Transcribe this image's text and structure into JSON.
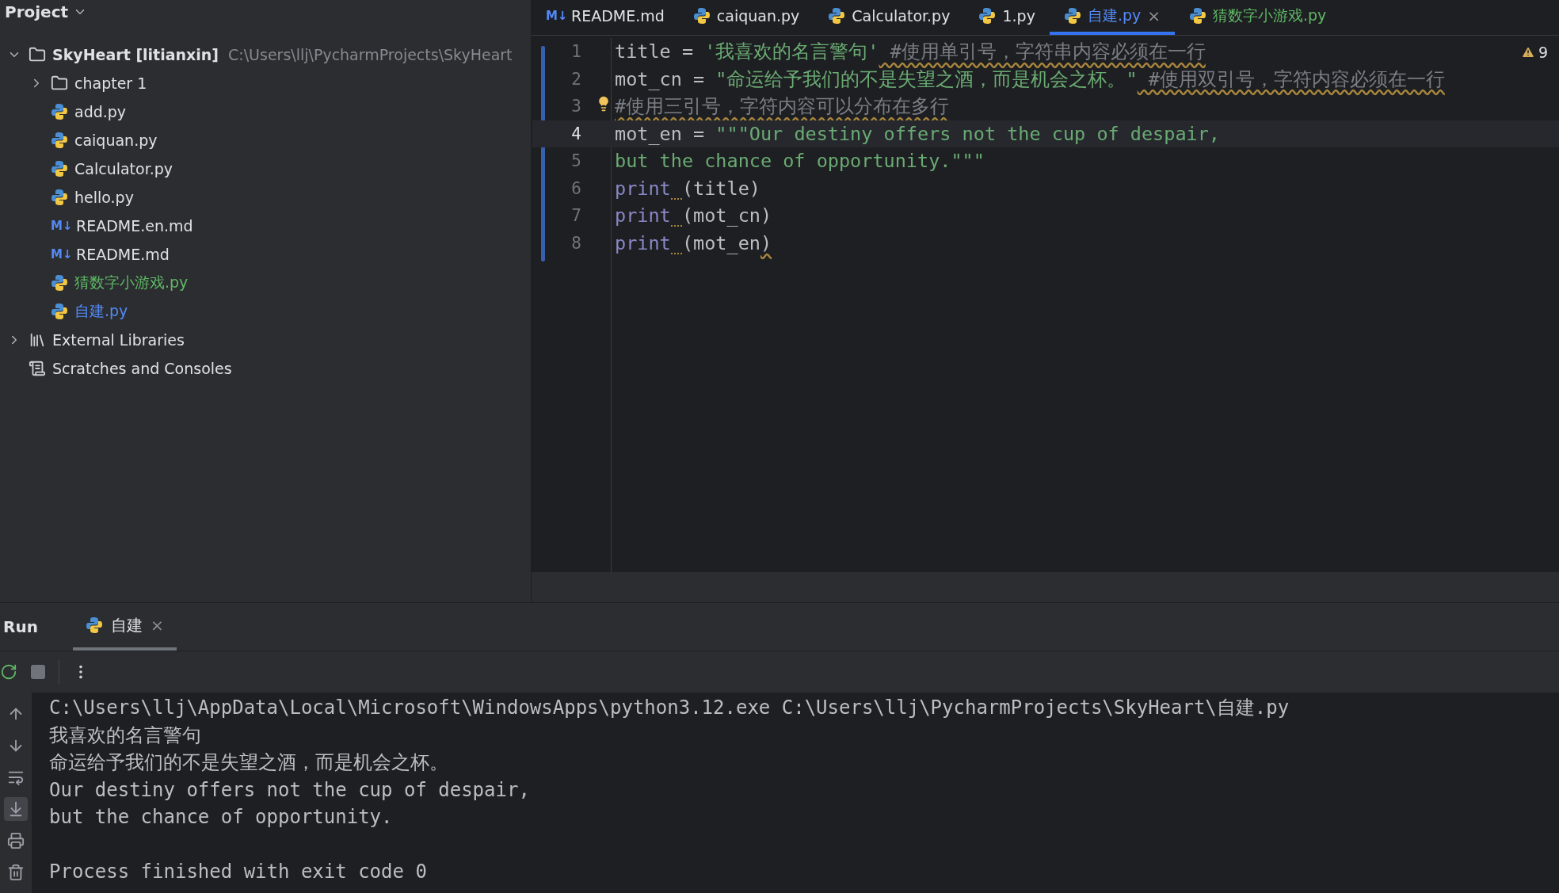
{
  "project": {
    "title": "Project",
    "tree": [
      {
        "kind": "folder",
        "label": "SkyHeart [litianxin]",
        "path": "C:\\Users\\llj\\PycharmProjects\\SkyHeart",
        "expanded": true,
        "children": [
          {
            "kind": "folder",
            "label": "chapter 1",
            "expanded": false
          },
          {
            "kind": "python",
            "label": "add.py",
            "color": "#dfe1e5"
          },
          {
            "kind": "python",
            "label": "caiquan.py",
            "color": "#dfe1e5"
          },
          {
            "kind": "python",
            "label": "Calculator.py",
            "color": "#dfe1e5"
          },
          {
            "kind": "python",
            "label": "hello.py",
            "color": "#dfe1e5"
          },
          {
            "kind": "markdown",
            "icon_text": "M↓",
            "label": "README.en.md",
            "color": "#dfe1e5"
          },
          {
            "kind": "markdown",
            "icon_text": "M↓",
            "label": "README.md",
            "color": "#dfe1e5"
          },
          {
            "kind": "python",
            "label": "猜数字小游戏.py",
            "color": "#5fb865"
          },
          {
            "kind": "python",
            "label": "自建.py",
            "color": "#548af7"
          }
        ]
      },
      {
        "kind": "library",
        "label": "External Libraries",
        "expanded": false
      },
      {
        "kind": "scratches",
        "label": "Scratches and Consoles"
      }
    ]
  },
  "editor": {
    "tabs": [
      {
        "kind": "markdown",
        "icon_text": "M↓",
        "label": "README.md",
        "color": "#dfe1e5",
        "selected": false
      },
      {
        "kind": "python",
        "label": "caiquan.py",
        "color": "#dfe1e5",
        "selected": false
      },
      {
        "kind": "python",
        "label": "Calculator.py",
        "color": "#dfe1e5",
        "selected": false
      },
      {
        "kind": "python",
        "label": "1.py",
        "color": "#dfe1e5",
        "selected": false
      },
      {
        "kind": "python",
        "label": "自建.py",
        "color": "#548af7",
        "selected": true,
        "close": "×"
      },
      {
        "kind": "python",
        "label": "猜数字小游戏.py",
        "color": "#5fb865",
        "selected": false
      }
    ],
    "warnings": "9",
    "lines": [
      {
        "number": "1",
        "current": false,
        "tokens": [
          {
            "kind": "plain",
            "text": "title = "
          },
          {
            "kind": "string",
            "text": "'我喜欢的名言警句'"
          },
          {
            "kind": "comment",
            "text": " #使用单引号，字符串内容必须在一行",
            "warn": true
          }
        ]
      },
      {
        "number": "2",
        "current": false,
        "tokens": [
          {
            "kind": "plain",
            "text": "mot_cn = "
          },
          {
            "kind": "string",
            "text": "\"命运给予我们的不是失望之酒，而是机会之杯。\""
          },
          {
            "kind": "comment",
            "text": " #使用双引号，字符内容必须在一行",
            "warn": true
          }
        ]
      },
      {
        "number": "3",
        "current": false,
        "bulb": true,
        "tokens": [
          {
            "kind": "comment",
            "text": "#使用三引号，字符内容可以分布在多行",
            "warn": true
          }
        ]
      },
      {
        "number": "4",
        "current": true,
        "tokens": [
          {
            "kind": "plain",
            "text": "mot_en = "
          },
          {
            "kind": "string",
            "text": "\"\"\"Our destiny offers not the cup of despair,"
          }
        ]
      },
      {
        "number": "5",
        "current": false,
        "tokens": [
          {
            "kind": "string",
            "text": "but the chance of opportunity.\"\"\""
          }
        ]
      },
      {
        "number": "6",
        "current": false,
        "tokens": [
          {
            "kind": "function",
            "text": "print",
            "warn_after": true
          },
          {
            "kind": "plain",
            "text": "(title)"
          }
        ]
      },
      {
        "number": "7",
        "current": false,
        "tokens": [
          {
            "kind": "function",
            "text": "print",
            "warn_after": true
          },
          {
            "kind": "plain",
            "text": "(mot_cn)"
          }
        ]
      },
      {
        "number": "8",
        "current": false,
        "tokens": [
          {
            "kind": "function",
            "text": "print",
            "warn_after": true
          },
          {
            "kind": "plain",
            "text": "(mot_en"
          },
          {
            "kind": "plain",
            "text": ")",
            "warn": true
          }
        ]
      }
    ]
  },
  "run": {
    "title": "Run",
    "tabs": [
      {
        "label": "自建",
        "selected": true,
        "close": "×"
      }
    ],
    "side_tools": [
      {
        "kind": "up",
        "selected": false
      },
      {
        "kind": "down",
        "selected": false
      },
      {
        "kind": "wrap",
        "selected": false
      },
      {
        "kind": "scroll-end",
        "selected": true
      },
      {
        "kind": "print",
        "selected": false
      },
      {
        "kind": "trash",
        "selected": false
      }
    ],
    "output": [
      {
        "kind": "text",
        "text": "C:\\Users\\llj\\AppData\\Local\\Microsoft\\WindowsApps\\python3.12.exe C:\\Users\\llj\\PycharmProjects\\SkyHeart\\自建.py"
      },
      {
        "kind": "text",
        "text": "我喜欢的名言警句"
      },
      {
        "kind": "text",
        "text": "命运给予我们的不是失望之酒，而是机会之杯。"
      },
      {
        "kind": "text",
        "text": "Our destiny offers not the cup of despair,"
      },
      {
        "kind": "text",
        "text": "but the chance of opportunity."
      },
      {
        "kind": "blank"
      },
      {
        "kind": "text",
        "text": "Process finished with exit code 0"
      }
    ]
  }
}
